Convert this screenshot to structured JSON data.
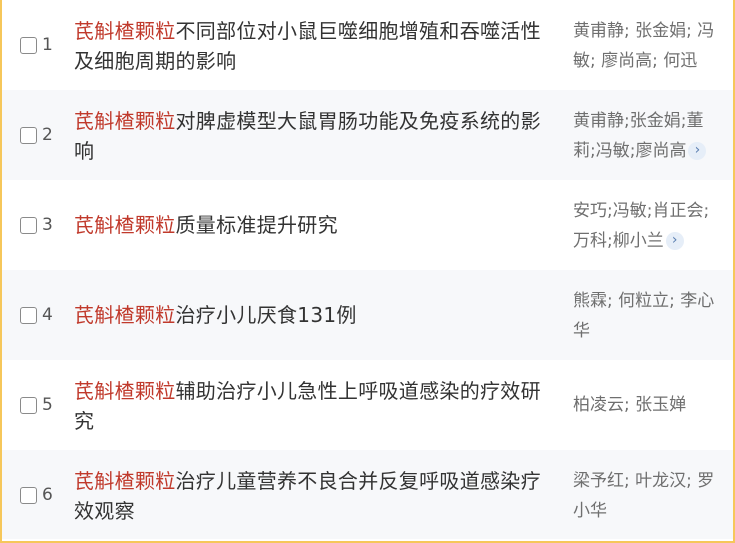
{
  "results": [
    {
      "num": "1",
      "keyword": "芪斛楂颗粒",
      "title_rest": "不同部位对小鼠巨噬细胞增殖和吞噬活性及细胞周期的影响",
      "authors": "黄甫静; 张金娟; 冯敏; 廖尚高; 何迅",
      "has_more": false
    },
    {
      "num": "2",
      "keyword": "芪斛楂颗粒",
      "title_rest": "对脾虚模型大鼠胃肠功能及免疫系统的影响",
      "authors": "黄甫静;张金娟;董莉;冯敏;廖尚高",
      "has_more": true
    },
    {
      "num": "3",
      "keyword": "芪斛楂颗粒",
      "title_rest": "质量标准提升研究",
      "authors": "安巧;冯敏;肖正会;万科;柳小兰",
      "has_more": true
    },
    {
      "num": "4",
      "keyword": "芪斛楂颗粒",
      "title_rest": "治疗小儿厌食131例",
      "authors": "熊霖; 何粒立; 李心华",
      "has_more": false
    },
    {
      "num": "5",
      "keyword": "芪斛楂颗粒",
      "title_rest": "辅助治疗小儿急性上呼吸道感染的疗效研究",
      "authors": "柏凌云; 张玉婵",
      "has_more": false
    },
    {
      "num": "6",
      "keyword": "芪斛楂颗粒",
      "title_rest": "治疗儿童营养不良合并反复呼吸道感染疗效观察",
      "authors": "梁予红; 叶龙汉; 罗小华",
      "has_more": false
    }
  ],
  "more_icon": "chevron-right-icon",
  "colors": {
    "keyword": "#c0392b",
    "row_shade": "#f7f8fa",
    "frame_border": "#f6c75a",
    "title": "#333333",
    "authors": "#6f6f6f"
  }
}
